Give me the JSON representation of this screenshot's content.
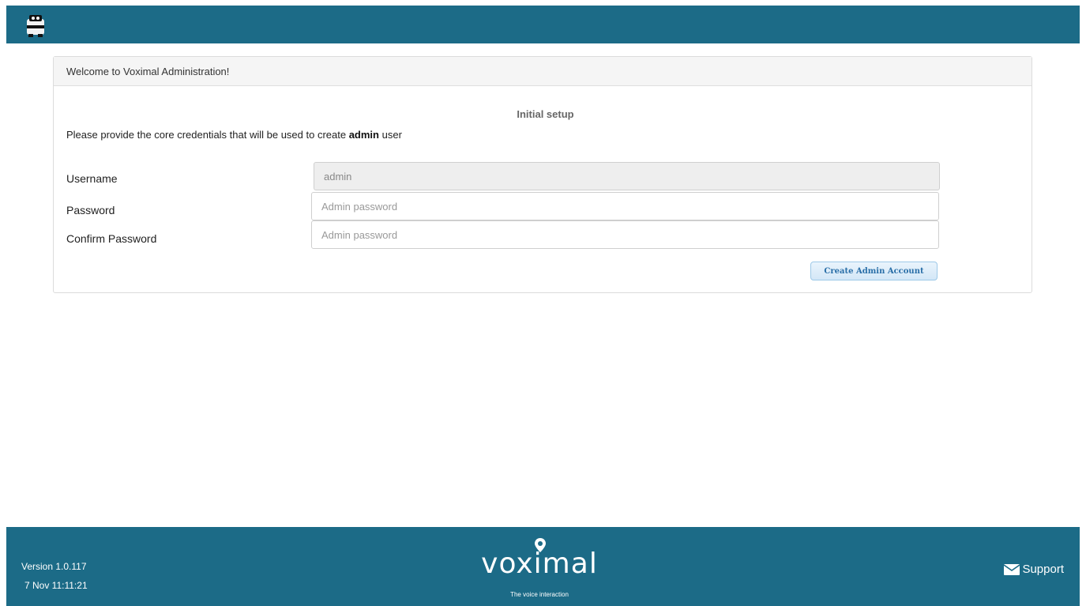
{
  "header": {
    "logo_icon": "robot-icon"
  },
  "panel": {
    "heading": "Welcome to Voximal Administration!",
    "setup_title": "Initial setup",
    "intro_before": "Please provide the core credentials that will be used to create ",
    "intro_bold": "admin",
    "intro_after": " user"
  },
  "form": {
    "username_label": "Username",
    "username_value": "admin",
    "password_label": "Password",
    "password_placeholder": "Admin password",
    "confirm_label": "Confirm Password",
    "confirm_placeholder": "Admin password",
    "submit_label": "Create Admin Account"
  },
  "footer": {
    "version": "Version 1.0.117",
    "date": "7 Nov 11:11:21",
    "logo_text": "voximal",
    "tagline": "The voice interaction",
    "support_label": "Support",
    "support_icon": "envelope-icon"
  },
  "colors": {
    "brand": "#1c6b87",
    "button_text": "#2a6fa8"
  }
}
